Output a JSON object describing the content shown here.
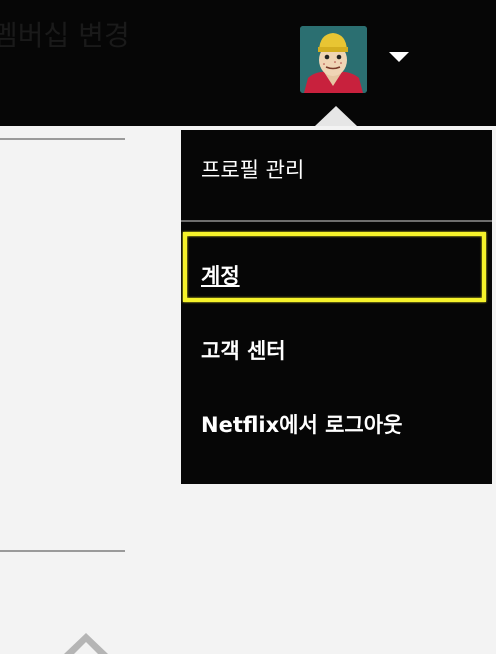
{
  "header": {
    "page_title": "멤버십 변경"
  },
  "account_menu": {
    "items": [
      {
        "label": "프로필 관리"
      },
      {
        "label": "계정"
      },
      {
        "label": "고객 센터"
      },
      {
        "label": "Netflix에서 로그아웃"
      }
    ],
    "highlight_color": "#f5f22a"
  },
  "icons": {
    "avatar": "profile-avatar",
    "caret": "caret-down-icon",
    "scroll": "chevron-up-icon"
  },
  "colors": {
    "topbar": "#060606",
    "page_background": "#f3f3f3",
    "menu_background": "#060606",
    "menu_text": "#ffffff"
  }
}
